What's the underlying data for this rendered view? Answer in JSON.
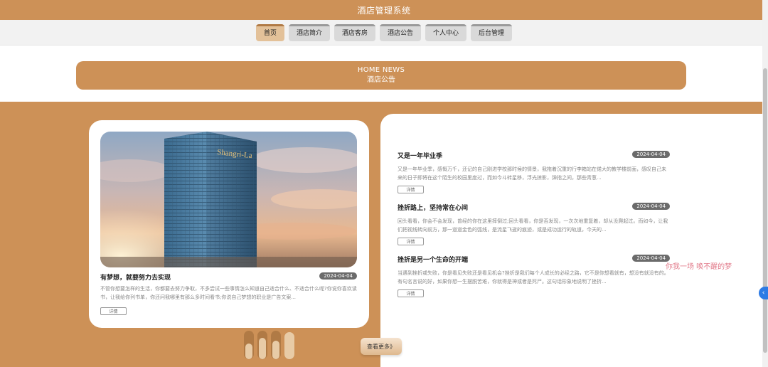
{
  "header": {
    "title": "酒店管理系统"
  },
  "nav": {
    "items": [
      {
        "label": "首页"
      },
      {
        "label": "酒店简介"
      },
      {
        "label": "酒店客房"
      },
      {
        "label": "酒店公告"
      },
      {
        "label": "个人中心"
      },
      {
        "label": "后台管理"
      }
    ],
    "active_index": 0
  },
  "section": {
    "title_en": "HOME NEWS",
    "title_cn": "酒店公告"
  },
  "feature": {
    "title": "有梦想，就要努力去实现",
    "date": "2024-04-04",
    "desc": "不管你想要怎样的生活，你都要去努力争取，不多尝试一些事情怎么知道自己适合什么、不适合什么呢?你说你喜欢读书，让我给你列书单，你还问我哪里有那么多时间看书;你说自己梦想的职业是广告文案...",
    "detail_label": "详情",
    "image_sign": "Shangri-La"
  },
  "news": [
    {
      "title": "又是一年毕业季",
      "date": "2024-04-04",
      "desc": "又是一年毕业季，感慨万千，还记的自己刚进学校那时候的情景，我拖着沉重的行李箱站在偌大的教学楼前面，感叹自己未来的日子即将在这个陌生的校园里度过，而如今斗转星移，浮光掠影，弹指之间，那些青葱...",
      "detail_label": "详情"
    },
    {
      "title": "挫折路上，坚持常在心间",
      "date": "2024-04-04",
      "desc": "回头看看，你会不会发现，曾经的你在这里摔倒过;回头看看，你是否发现，一次次地重复着，却从没爬起过。而如今，让我们把视线转向前方，那一道道金色的弧线，是流星飞逝的痕迹，或是成功运行的轨道，今天的...",
      "detail_label": "详情"
    },
    {
      "title": "挫折是另一个生命的开端",
      "date": "2024-04-04",
      "desc": "当遇到挫折或失败，你是看见失败还是看见机会?挫折是我们每个人成长的必经之路，它不是你想看就有，想没有就没有的。有句名言说的好，如果你想一生摆脱苦难，你就得是神或者是死尸。这句话形象地说明了挫折...",
      "detail_label": "详情"
    }
  ],
  "overlay_text": "你我一场 唤不醒的梦",
  "more_label": "查看更多》",
  "side_toggle_icon": "‹",
  "colors": {
    "brand": "#cd9157",
    "nav_active": "#e3c199",
    "date_badge": "#6b6b6b",
    "overlay_text": "#e27a8a",
    "side_toggle": "#2d7be5"
  }
}
